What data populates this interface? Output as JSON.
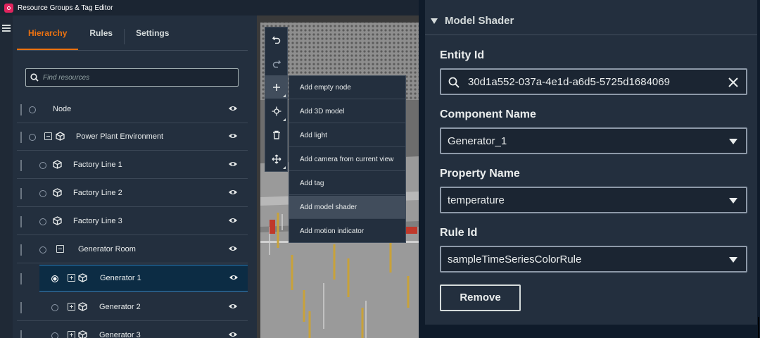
{
  "window": {
    "title": "Resource Groups & Tag Editor"
  },
  "tabs": [
    {
      "label": "Hierarchy",
      "active": true
    },
    {
      "label": "Rules",
      "active": false
    },
    {
      "label": "Settings",
      "active": false
    }
  ],
  "search": {
    "placeholder": "Find resources"
  },
  "hierarchy": [
    {
      "label": "Node"
    },
    {
      "label": "Power Plant Environment"
    },
    {
      "label": "Factory Line 1"
    },
    {
      "label": "Factory Line 2"
    },
    {
      "label": "Factory Line 3"
    },
    {
      "label": "Generator Room"
    },
    {
      "label": "Generator 1",
      "selected": true
    },
    {
      "label": "Generator 2"
    },
    {
      "label": "Generator 3"
    }
  ],
  "add_menu": {
    "items": [
      {
        "label": "Add empty node"
      },
      {
        "label": "Add 3D model"
      },
      {
        "label": "Add light"
      },
      {
        "label": "Add camera from current view"
      },
      {
        "label": "Add tag"
      },
      {
        "label": "Add model shader",
        "hover": true
      },
      {
        "label": "Add motion indicator"
      }
    ]
  },
  "inspector": {
    "section_title": "Model Shader",
    "entity_id": {
      "label": "Entity Id",
      "value": "30d1a552-037a-4e1d-a6d5-5725d1684069"
    },
    "component_name": {
      "label": "Component Name",
      "value": "Generator_1"
    },
    "property_name": {
      "label": "Property Name",
      "value": "temperature"
    },
    "rule_id": {
      "label": "Rule Id",
      "value": "sampleTimeSeriesColorRule"
    },
    "remove_label": "Remove"
  },
  "colors": {
    "accent": "#ec7211",
    "panel": "#232f3e",
    "selected_row": "#0c2c44"
  }
}
